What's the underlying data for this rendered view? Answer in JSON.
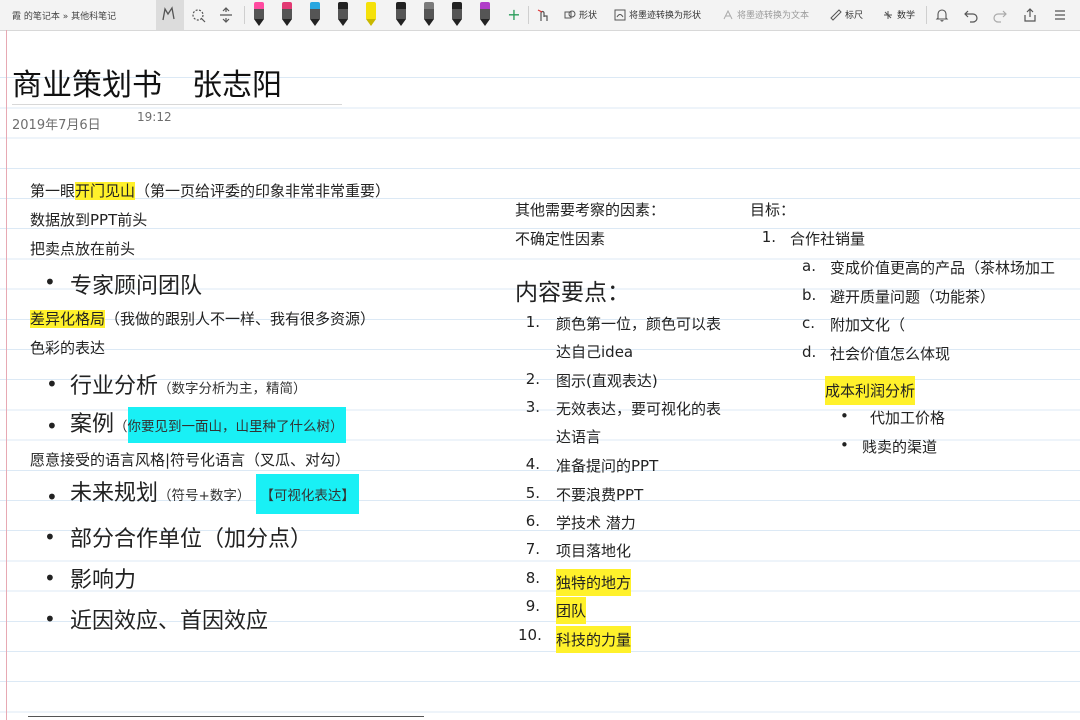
{
  "breadcrumb": "霞 的笔记本 » 其他科笔记",
  "toolbar": {
    "pens": [
      {
        "cap": "#ff4aa0"
      },
      {
        "cap": "#e23a73"
      },
      {
        "cap": "#2aa7e0"
      },
      {
        "cap": "#222222"
      },
      {
        "cap": "#f5e10a"
      },
      {
        "cap": "#222222"
      },
      {
        "cap": "#7a7a7a"
      },
      {
        "cap": "#222222"
      },
      {
        "cap": "#b03cc8"
      }
    ],
    "shapes_label": "形状",
    "ink_to_shape_label": "将墨迹转换为形状",
    "ink_to_text_label": "将墨迹转换为文本",
    "ruler_label": "标尺",
    "math_label": "数学"
  },
  "title": "商业策划书　张志阳",
  "date": "2019年7月6日",
  "time": "19:12",
  "left": {
    "line1_pre": "第一眼",
    "line1_hl": "开门见山",
    "line1_post": "（第一页给评委的印象非常非常重要）",
    "line2": "数据放到PPT前头",
    "line3": "把卖点放在前头",
    "bullet1": "专家顾问团队",
    "diff_hl": "差异化格局",
    "diff_post": "（我做的跟别人不一样、我有很多资源）",
    "color": "色彩的表达",
    "bullet2": "行业分析",
    "bullet2_sub": "（数字分析为主，精简）",
    "bullet3": "案例",
    "bullet3_paren": "（",
    "bullet3_cy": "你要见到一面山，山里种了什么树",
    "bullet3_close": "）",
    "style": "愿意接受的语言风格|符号化语言（叉瓜、对勾）",
    "bullet4": "未来规划",
    "bullet4_sub": "（符号+数字）",
    "bullet4_cy": "【可视化表达】",
    "bullet5": "部分合作单位（加分点）",
    "bullet6": "影响力",
    "bullet7": "近因效应、首因效应"
  },
  "middle": {
    "factors": "其他需要考察的因素：",
    "uncertain": "不确定性因素",
    "heading": "内容要点：",
    "items": [
      {
        "n": "1.",
        "l1": "颜色第一位，颜色可以表",
        "l2": "达自己idea",
        "hl": false
      },
      {
        "n": "2.",
        "l1": "图示(直观表达)",
        "hl": false
      },
      {
        "n": "3.",
        "l1": "无效表达，要可视化的表",
        "l2": "达语言",
        "hl": false
      },
      {
        "n": "4.",
        "l1": "准备提问的PPT",
        "hl": false
      },
      {
        "n": "5.",
        "l1": "不要浪费PPT",
        "hl": false
      },
      {
        "n": "6.",
        "l1": "学技术 潜力",
        "hl": false
      },
      {
        "n": "7.",
        "l1": "项目落地化",
        "hl": false
      },
      {
        "n": "8.",
        "l1": "独特的地方",
        "hl": true
      },
      {
        "n": "9.",
        "l1": "团队",
        "hl": true
      },
      {
        "n": "10.",
        "l1": "科技的力量",
        "hl": true
      }
    ]
  },
  "right": {
    "goal": "目标：",
    "goal1_n": "1.",
    "goal1": "合作社销量",
    "subs": [
      {
        "n": "a.",
        "t": "变成价值更高的产品（茶林场加工"
      },
      {
        "n": "b.",
        "t": "避开质量问题（功能茶）"
      },
      {
        "n": "c.",
        "t": "附加文化（"
      },
      {
        "n": "d.",
        "t": "社会价值怎么体现"
      }
    ],
    "cost_hl": "成本利润分析",
    "cost_items": [
      "代加工价格",
      "贱卖的渠道"
    ]
  }
}
